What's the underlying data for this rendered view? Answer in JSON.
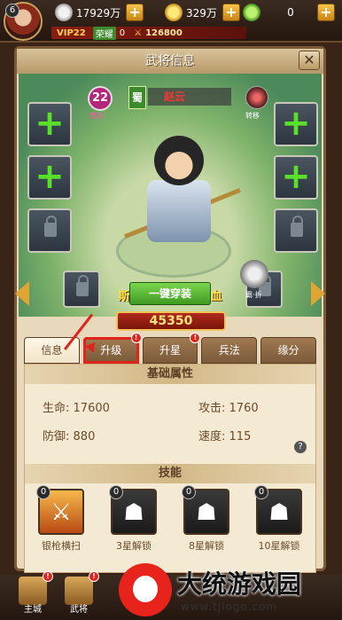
{
  "topbar": {
    "avatar_level": "6",
    "silver": "17929万",
    "gold": "329万",
    "jade": "0",
    "vip": "VIP22",
    "honor_label": "荣耀",
    "honor_value": "0",
    "power": "126800",
    "plus": "+"
  },
  "panel": {
    "title": "武将信息",
    "close": "✕"
  },
  "hero": {
    "level": "22",
    "level_caption": "真英",
    "type": "蜀",
    "name": "赵云",
    "skill_orb_label": "转移",
    "companion_label": "霸·折",
    "skill_text": "斯伤追击，掠夺回血",
    "equip_button": "一键穿装",
    "power": "45350"
  },
  "tabs": [
    {
      "label": "信息"
    },
    {
      "label": "升级"
    },
    {
      "label": "升星"
    },
    {
      "label": "兵法"
    },
    {
      "label": "缘分"
    }
  ],
  "attributes": {
    "title": "基础属性",
    "hp_label": "生命:",
    "hp": "17600",
    "atk_label": "攻击:",
    "atk": "1760",
    "def_label": "防御:",
    "def": "880",
    "spd_label": "速度:",
    "spd": "115",
    "help": "?"
  },
  "skills": {
    "title": "技能",
    "items": [
      {
        "level": "0",
        "label": "银枪横扫"
      },
      {
        "level": "0",
        "label": "3星解锁"
      },
      {
        "level": "0",
        "label": "8星解锁"
      },
      {
        "level": "0",
        "label": "10星解锁"
      }
    ]
  },
  "bottom_nav": [
    {
      "label": "主城"
    },
    {
      "label": "武将"
    }
  ],
  "watermark": {
    "title": "大统游戏园",
    "url": "www.tjlogo.com"
  },
  "colors": {
    "accent_green": "#3f9a22",
    "alert_red": "#e0231b",
    "panel_bg": "#e8d9bd"
  }
}
